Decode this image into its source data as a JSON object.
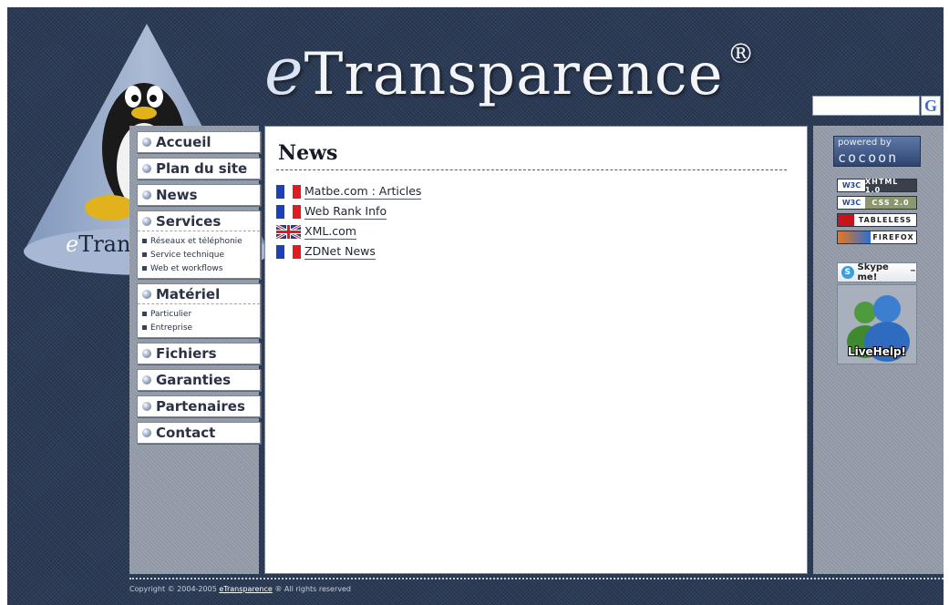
{
  "header": {
    "brand_initial": "e",
    "brand_rest": "Transparence",
    "registered_mark": "®",
    "cone_brand_initial": "e",
    "cone_brand_text": "Transp"
  },
  "search": {
    "value": "",
    "button_label": "G"
  },
  "nav": {
    "accueil": "Accueil",
    "plan": "Plan du site",
    "news": "News",
    "services": {
      "label": "Services",
      "subitems": [
        "Réseaux et téléphonie",
        "Service technique",
        "Web et workflows"
      ]
    },
    "materiel": {
      "label": "Matériel",
      "subitems": [
        "Particulier",
        "Entreprise"
      ]
    },
    "fichiers": "Fichiers",
    "garanties": "Garanties",
    "partenaires": "Partenaires",
    "contact": "Contact"
  },
  "main": {
    "title": "News",
    "items": [
      {
        "label": "Matbe.com : Articles",
        "flag": "flag-france-icon"
      },
      {
        "label": "Web Rank Info",
        "flag": "flag-france-icon"
      },
      {
        "label": "XML.com",
        "flag": "flag-uk-icon"
      },
      {
        "label": "ZDNet News",
        "flag": "flag-france-icon"
      }
    ]
  },
  "badges": {
    "cocoon_top": "powered by",
    "cocoon_bottom": "cocoon",
    "xhtml_left": "W3C",
    "xhtml_right": "XHTML 1.0",
    "css_left": "W3C",
    "css_right": "CSS 2.0",
    "tableless": "TABLELESS",
    "firefox": "FIREFOX",
    "skype": "Skype me!",
    "skype_tm": "™",
    "livehelp": "LiveHelp!"
  },
  "footer": {
    "prefix": "Copyright © 2004-2005",
    "brand": "eTransparence",
    "suffix": "® All rights reserved"
  },
  "colors": {
    "background": "#2a3a55",
    "sidebar": "#8f98a4",
    "content": "#ffffff",
    "text": "#1e2433"
  }
}
